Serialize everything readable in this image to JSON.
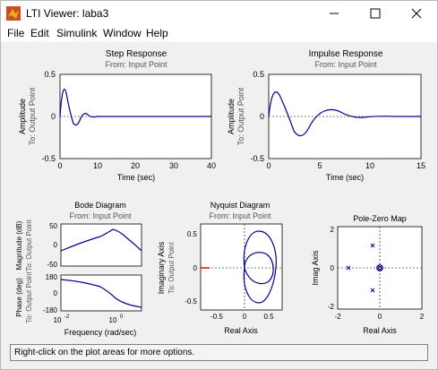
{
  "window": {
    "title": "LTI Viewer: laba3"
  },
  "menu": [
    "File",
    "Edit",
    "Simulink",
    "Window",
    "Help"
  ],
  "plots": {
    "step": {
      "title": "Step Response",
      "subtitle": "From: Input Point",
      "ylabel": "Amplitude",
      "ylabel2": "To: Output Point",
      "xlabel": "Time (sec)",
      "xticks": [
        "0",
        "10",
        "20",
        "30",
        "40"
      ],
      "yticks": [
        "0.5",
        "0",
        "-0.5"
      ]
    },
    "impulse": {
      "title": "Impulse Response",
      "subtitle": "From: Input Point",
      "ylabel": "Amplitude",
      "ylabel2": "To: Output Point",
      "xlabel": "Time (sec)",
      "xticks": [
        "0",
        "5",
        "10",
        "15"
      ],
      "yticks": [
        "0.5",
        "0",
        "-0.5"
      ]
    },
    "bode": {
      "title": "Bode Diagram",
      "subtitle": "From: Input Point",
      "ylabel_mag": "Magnitude (dB)",
      "ylabel_phase": "Phase (deg)",
      "ylabel2_mag": "To: Output Point",
      "ylabel2_phase": "To: Output Point",
      "xlabel": "Frequency (rad/sec)",
      "mag_ticks": [
        "50",
        "0",
        "-50"
      ],
      "phase_ticks": [
        "180",
        "0",
        "-180"
      ],
      "xticks": [
        "10",
        "10"
      ],
      "xtick_exps": [
        "-2",
        "0"
      ]
    },
    "nyquist": {
      "title": "Nyquist Diagram",
      "subtitle": "From: Input Point",
      "ylabel": "Imaginary Axis",
      "ylabel2": "To: Output Point",
      "xlabel": "Real Axis",
      "xticks": [
        "-0.5",
        "0",
        "0.5"
      ],
      "yticks": [
        "0.5",
        "0",
        "-0.5"
      ]
    },
    "pz": {
      "title": "Pole-Zero Map",
      "ylabel": "Imag Axis",
      "xlabel": "Real Axis",
      "xticks": [
        "-2",
        "0",
        "2"
      ],
      "yticks": [
        "2",
        "0",
        "-2"
      ]
    }
  },
  "status": "Right-click on the plot areas for more options.",
  "colors": {
    "trace": "#00008b",
    "zero_line": "#000000",
    "critical": "#ff0000"
  }
}
